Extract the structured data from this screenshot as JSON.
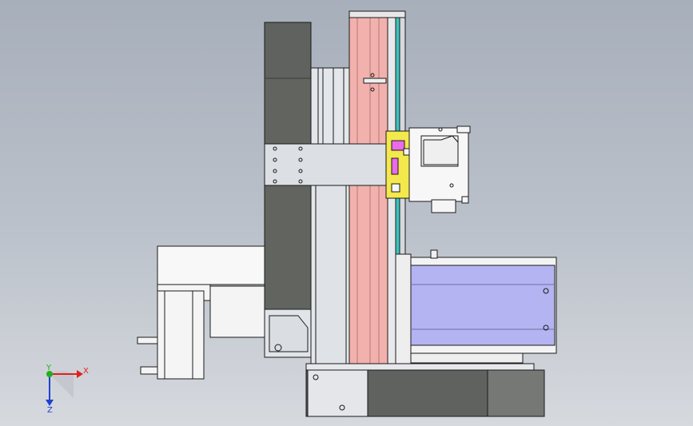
{
  "viewport": {
    "background_top": "#a7afbb",
    "background_bottom": "#d6d9de"
  },
  "triad": {
    "x_label": "X",
    "y_label": "Y",
    "z_label": "Z",
    "x_color": "#e02020",
    "y_color": "#20b020",
    "z_color": "#2040d0"
  },
  "colors": {
    "outline": "#1a1a1a",
    "dark_housing": "#5f625e",
    "light_metal": "#d9dde2",
    "white_part": "#f4f4f4",
    "pink_rail": "#f2b1ad",
    "cyan_strip": "#3cc3c0",
    "yellow_carriage": "#f3e84c",
    "lavender_slide": "#b4b4f2",
    "magenta_marker": "#e96be9"
  }
}
